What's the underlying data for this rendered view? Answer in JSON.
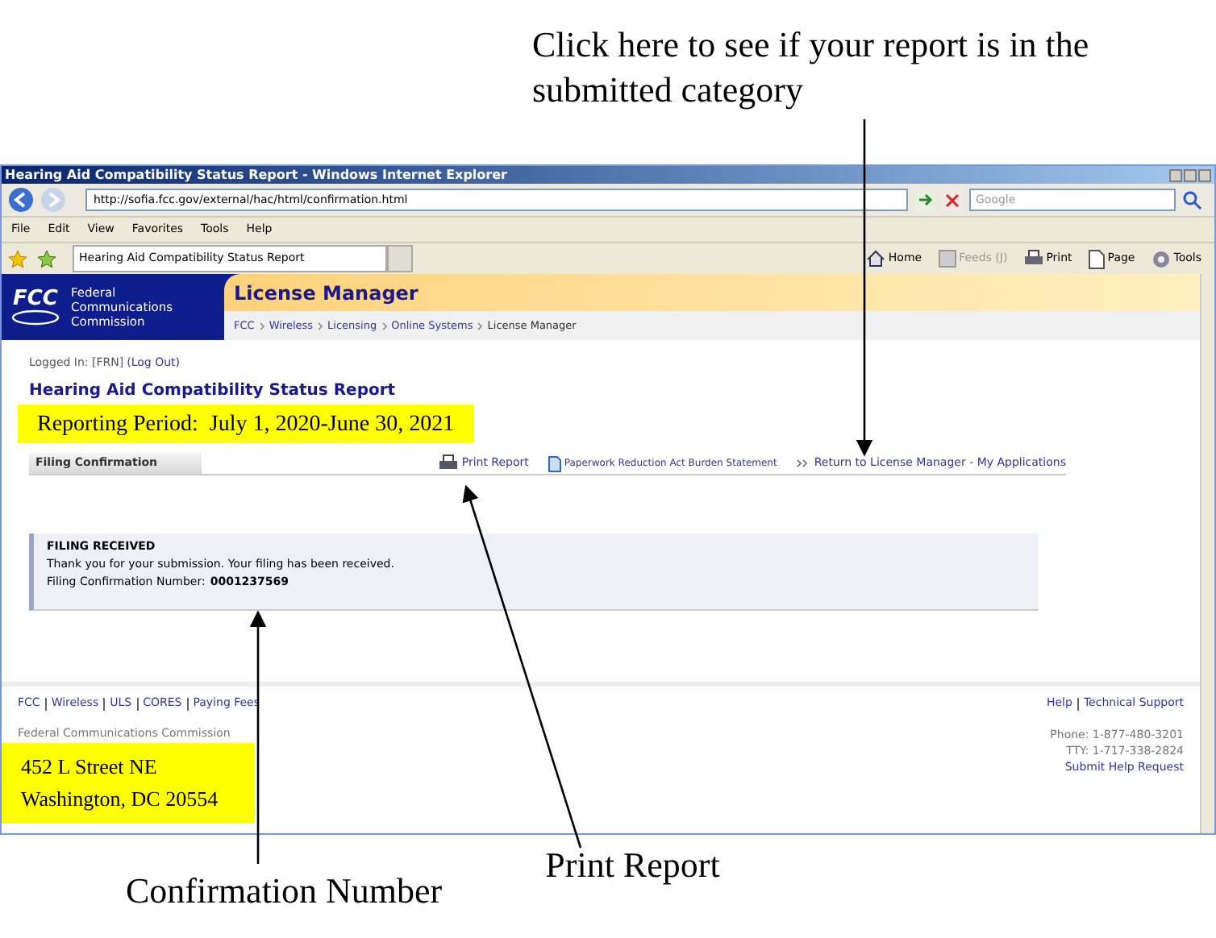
{
  "annotations": {
    "top": "Click here to see if your report is in the submitted category",
    "bottom_left": "Confirmation Number",
    "bottom_center": "Print Report"
  },
  "window": {
    "title": "Hearing Aid Compatibility Status Report - Windows Internet Explorer"
  },
  "address_bar": {
    "url": "http://sofia.fcc.gov/external/hac/html/confirmation.html"
  },
  "search": {
    "placeholder": "Google"
  },
  "menu": [
    "File",
    "Edit",
    "View",
    "Favorites",
    "Tools",
    "Help"
  ],
  "tabs": [
    {
      "label": "Hearing Aid Compatibility Status Report",
      "selected": true
    }
  ],
  "command_bar": [
    {
      "kind": "home",
      "label": "Home",
      "disabled": false
    },
    {
      "kind": "feeds",
      "label": "Feeds (J)",
      "disabled": true
    },
    {
      "kind": "print",
      "label": "Print",
      "disabled": false
    },
    {
      "kind": "page",
      "label": "Page",
      "disabled": false
    },
    {
      "kind": "tools",
      "label": "Tools",
      "disabled": false
    }
  ],
  "header": {
    "logo_text": "FCC",
    "agency": [
      "Federal",
      "Communications",
      "Commission"
    ],
    "app_title": "License Manager",
    "breadcrumb": [
      "FCC",
      "Wireless",
      "Licensing",
      "Online Systems",
      "License Manager"
    ]
  },
  "login": {
    "label": "Logged In: [FRN]",
    "link": "(Log Out)"
  },
  "page_title": "Hearing Aid Compatibility Status Report",
  "reporting_period": "Reporting Period:  July 1, 2020-June 30, 2021",
  "section_tab": "Filing Confirmation",
  "actions": [
    {
      "kind": "print",
      "label": "Print Report"
    },
    {
      "kind": "document",
      "label": "Paperwork Reduction Act Burden Statement"
    },
    {
      "kind": "return",
      "label": "Return to License Manager - My Applications"
    }
  ],
  "notice": {
    "title": "FILING RECEIVED",
    "message": "Thank you for your submission. Your filing has been received.",
    "number_label": "Filing Confirmation Number:",
    "number": "0001237569"
  },
  "footer": {
    "links": [
      "FCC",
      "Wireless",
      "ULS",
      "CORES",
      "Paying Fees"
    ],
    "help_links": [
      "Help",
      "Technical Support"
    ],
    "agency": "Federal Communications Commission",
    "address": [
      "452 L Street NE",
      "Washington, DC 20554"
    ],
    "phone": "Phone: 1-877-480-3201",
    "tty": "TTY: 1-717-338-2824",
    "help_request": "Submit Help Request"
  }
}
